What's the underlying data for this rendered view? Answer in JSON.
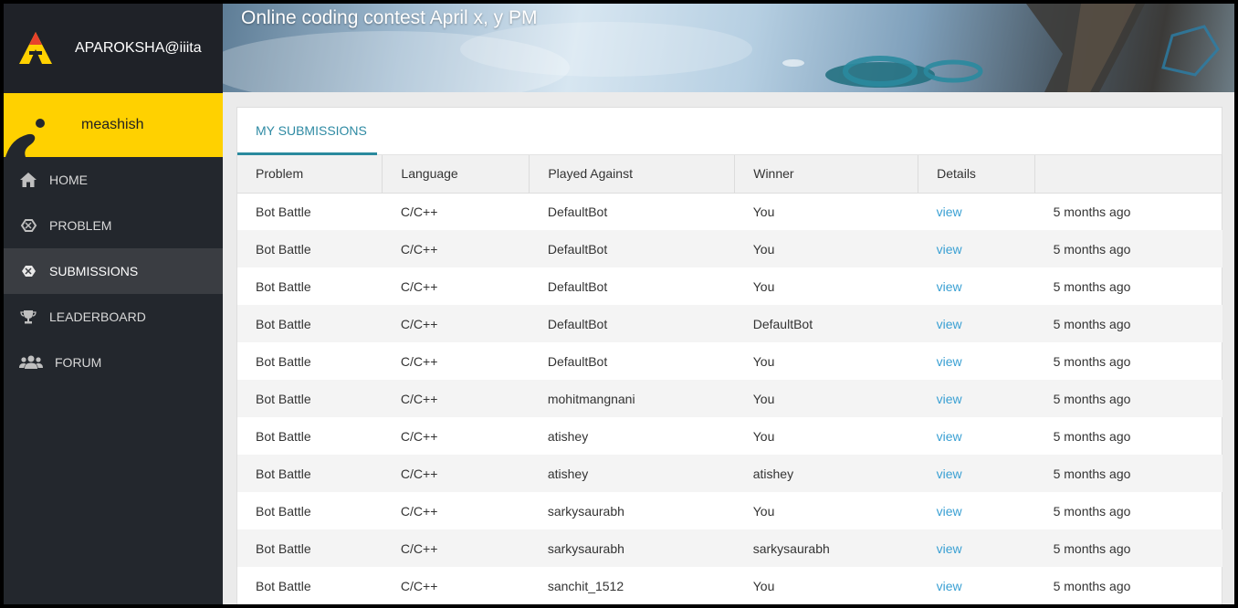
{
  "brand": {
    "name": "APAROKSHA@iiita",
    "logo_icon": "aparoksha-logo-icon"
  },
  "user": {
    "name": "meashish",
    "avatar_icon": "user-avatar-icon"
  },
  "nav": [
    {
      "label": "HOME",
      "icon": "home-icon",
      "active": false
    },
    {
      "label": "PROBLEM",
      "icon": "problem-icon",
      "active": false
    },
    {
      "label": "SUBMISSIONS",
      "icon": "submissions-icon",
      "active": true
    },
    {
      "label": "LEADERBOARD",
      "icon": "trophy-icon",
      "active": false
    },
    {
      "label": "FORUM",
      "icon": "users-icon",
      "active": false
    }
  ],
  "banner": {
    "title": "Online coding contest April x, y PM"
  },
  "tabs": [
    {
      "label": "MY SUBMISSIONS",
      "active": true
    }
  ],
  "table": {
    "headers": [
      "Problem",
      "Language",
      "Played Against",
      "Winner",
      "Details",
      ""
    ],
    "rows": [
      [
        "Bot Battle",
        "C/C++",
        "DefaultBot",
        "You",
        "view",
        "5 months ago"
      ],
      [
        "Bot Battle",
        "C/C++",
        "DefaultBot",
        "You",
        "view",
        "5 months ago"
      ],
      [
        "Bot Battle",
        "C/C++",
        "DefaultBot",
        "You",
        "view",
        "5 months ago"
      ],
      [
        "Bot Battle",
        "C/C++",
        "DefaultBot",
        "DefaultBot",
        "view",
        "5 months ago"
      ],
      [
        "Bot Battle",
        "C/C++",
        "DefaultBot",
        "You",
        "view",
        "5 months ago"
      ],
      [
        "Bot Battle",
        "C/C++",
        "mohitmangnani",
        "You",
        "view",
        "5 months ago"
      ],
      [
        "Bot Battle",
        "C/C++",
        "atishey",
        "You",
        "view",
        "5 months ago"
      ],
      [
        "Bot Battle",
        "C/C++",
        "atishey",
        "atishey",
        "view",
        "5 months ago"
      ],
      [
        "Bot Battle",
        "C/C++",
        "sarkysaurabh",
        "You",
        "view",
        "5 months ago"
      ],
      [
        "Bot Battle",
        "C/C++",
        "sarkysaurabh",
        "sarkysaurabh",
        "view",
        "5 months ago"
      ],
      [
        "Bot Battle",
        "C/C++",
        "sanchit_1512",
        "You",
        "view",
        "5 months ago"
      ]
    ]
  },
  "colors": {
    "sidebar": "#23272d",
    "accent_yellow": "#ffd100",
    "tab_accent": "#2a8a9e",
    "link": "#3aa0d3"
  }
}
